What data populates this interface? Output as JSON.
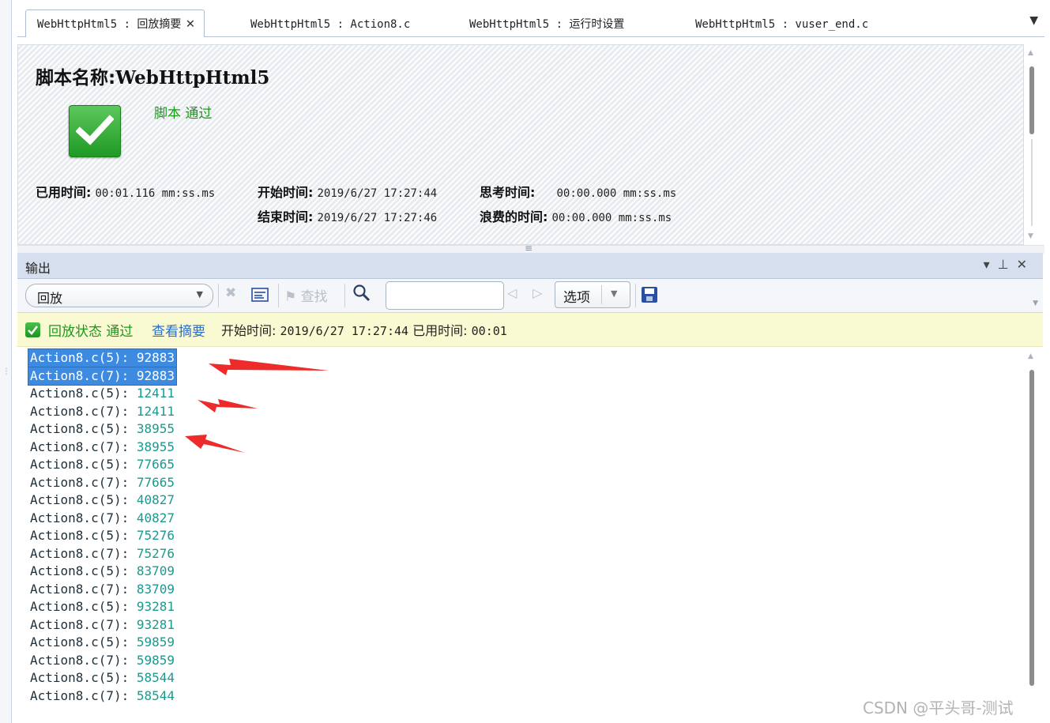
{
  "tabs": [
    {
      "label": "WebHttpHtml5 : 回放摘要",
      "active": true
    },
    {
      "label": "WebHttpHtml5 : Action8.c",
      "active": false
    },
    {
      "label": "WebHttpHtml5 : 运行时设置",
      "active": false
    },
    {
      "label": "WebHttpHtml5 : vuser_end.c",
      "active": false
    }
  ],
  "summary": {
    "title_label": "脚本名称:",
    "script_name": "WebHttpHtml5",
    "result_text": "脚本 通过",
    "elapsed_label": "已用时间:",
    "elapsed_value": "00:01.116 mm:ss.ms",
    "start_label": "开始时间:",
    "start_value": "2019/6/27 17:27:44",
    "end_label": "结束时间:",
    "end_value": "2019/6/27 17:27:46",
    "think_label": "思考时间:",
    "think_value": "00:00.000 mm:ss.ms",
    "wasted_label": "浪费的时间:",
    "wasted_value": "00:00.000 mm:ss.ms"
  },
  "output": {
    "title": "输出",
    "dropdown_value": "回放",
    "find_label": "查找",
    "find_value": "",
    "options_label": "选项"
  },
  "status": {
    "label": "回放状态 通过",
    "link": "查看摘要",
    "start_label": "开始时间:",
    "start_value": "2019/6/27 17:27:44",
    "elapsed_label": "已用时间:",
    "elapsed_value": "00:01"
  },
  "log_lines": [
    {
      "src": "Action8.c(5):",
      "num": "92883",
      "selected": true
    },
    {
      "src": "Action8.c(7):",
      "num": "92883",
      "selected": true
    },
    {
      "src": "Action8.c(5):",
      "num": "12411"
    },
    {
      "src": "Action8.c(7):",
      "num": "12411"
    },
    {
      "src": "Action8.c(5):",
      "num": "38955"
    },
    {
      "src": "Action8.c(7):",
      "num": "38955"
    },
    {
      "src": "Action8.c(5):",
      "num": "77665"
    },
    {
      "src": "Action8.c(7):",
      "num": "77665"
    },
    {
      "src": "Action8.c(5):",
      "num": "40827"
    },
    {
      "src": "Action8.c(7):",
      "num": "40827"
    },
    {
      "src": "Action8.c(5):",
      "num": "75276"
    },
    {
      "src": "Action8.c(7):",
      "num": "75276"
    },
    {
      "src": "Action8.c(5):",
      "num": "83709"
    },
    {
      "src": "Action8.c(7):",
      "num": "83709"
    },
    {
      "src": "Action8.c(5):",
      "num": "93281"
    },
    {
      "src": "Action8.c(7):",
      "num": "93281"
    },
    {
      "src": "Action8.c(5):",
      "num": "59859"
    },
    {
      "src": "Action8.c(7):",
      "num": "59859"
    },
    {
      "src": "Action8.c(5):",
      "num": "58544"
    },
    {
      "src": "Action8.c(7):",
      "num": "58544"
    }
  ],
  "watermark": "CSDN @平头哥-测试",
  "colors": {
    "pass_green": "#1a9a1a",
    "link_blue": "#2d6fc4",
    "selection": "#3d8be0",
    "annotation_red": "#ee2b2b",
    "status_bg": "#fafad2"
  }
}
